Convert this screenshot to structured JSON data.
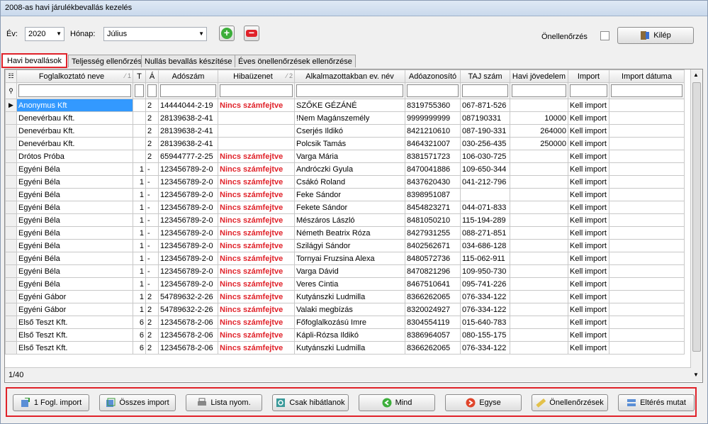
{
  "window": {
    "title": "2008-as havi járulékbevallás kezelés"
  },
  "toolbar": {
    "year_label": "Év:",
    "year_value": "2020",
    "month_label": "Hónap:",
    "month_value": "Július",
    "self_check_label": "Önellenőrzés",
    "exit_label": "Kilép"
  },
  "tabs": [
    {
      "label": "Havi bevallások",
      "active": true
    },
    {
      "label": "Teljesség ellenőrzés"
    },
    {
      "label": "Nullás bevallás készítése"
    },
    {
      "label": "Éves önellenőrzések ellenőrzése"
    }
  ],
  "grid": {
    "columns": [
      "Foglalkoztató neve",
      "T",
      "Á",
      "Adószám",
      "Hibaüzenet",
      "Alkalmazottakban ev. név",
      "Adóazonosító",
      "TAJ szám",
      "Havi jövedelem",
      "Import",
      "Import dátuma"
    ],
    "sort1": "1",
    "sort2": "2",
    "rows": [
      [
        "Anonymus Kft",
        "",
        "2",
        "14444044-2-19",
        "Nincs számfejtve",
        "SZŐKE GÉZÁNÉ",
        "8319755360",
        "067-871-526",
        "",
        "Kell import",
        ""
      ],
      [
        "Denevérbau Kft.",
        "",
        "2",
        "28139638-2-41",
        "",
        "!Nem Magánszemély",
        "9999999999",
        "087190331",
        "10000",
        "Kell import",
        ""
      ],
      [
        "Denevérbau Kft.",
        "",
        "2",
        "28139638-2-41",
        "",
        "Cserjés Ildikó",
        "8421210610",
        "087-190-331",
        "264000",
        "Kell import",
        ""
      ],
      [
        "Denevérbau Kft.",
        "",
        "2",
        "28139638-2-41",
        "",
        "Polcsik Tamás",
        "8464321007",
        "030-256-435",
        "250000",
        "Kell import",
        ""
      ],
      [
        "Drótos Próba",
        "",
        "2",
        "65944777-2-25",
        "Nincs számfejtve",
        "Varga Mária",
        "8381571723",
        "106-030-725",
        "",
        "Kell import",
        ""
      ],
      [
        "Egyéni Béla",
        "1",
        "-",
        "123456789-2-0",
        "Nincs számfejtve",
        "Andróczki Gyula",
        "8470041886",
        "109-650-344",
        "",
        "Kell import",
        ""
      ],
      [
        "Egyéni Béla",
        "1",
        "-",
        "123456789-2-0",
        "Nincs számfejtve",
        "Csákó Roland",
        "8437620430",
        "041-212-796",
        "",
        "Kell import",
        ""
      ],
      [
        "Egyéni Béla",
        "1",
        "-",
        "123456789-2-0",
        "Nincs számfejtve",
        "Feke Sándor",
        "8398951087",
        "",
        "",
        "Kell import",
        ""
      ],
      [
        "Egyéni Béla",
        "1",
        "-",
        "123456789-2-0",
        "Nincs számfejtve",
        "Fekete Sándor",
        "8454823271",
        "044-071-833",
        "",
        "Kell import",
        ""
      ],
      [
        "Egyéni Béla",
        "1",
        "-",
        "123456789-2-0",
        "Nincs számfejtve",
        "Mészáros László",
        "8481050210",
        "115-194-289",
        "",
        "Kell import",
        ""
      ],
      [
        "Egyéni Béla",
        "1",
        "-",
        "123456789-2-0",
        "Nincs számfejtve",
        "Németh Beatrix Róza",
        "8427931255",
        "088-271-851",
        "",
        "Kell import",
        ""
      ],
      [
        "Egyéni Béla",
        "1",
        "-",
        "123456789-2-0",
        "Nincs számfejtve",
        "Szilágyi Sándor",
        "8402562671",
        "034-686-128",
        "",
        "Kell import",
        ""
      ],
      [
        "Egyéni Béla",
        "1",
        "-",
        "123456789-2-0",
        "Nincs számfejtve",
        "Tornyai Fruzsina Alexa",
        "8480572736",
        "115-062-911",
        "",
        "Kell import",
        ""
      ],
      [
        "Egyéni Béla",
        "1",
        "-",
        "123456789-2-0",
        "Nincs számfejtve",
        "Varga Dávid",
        "8470821296",
        "109-950-730",
        "",
        "Kell import",
        ""
      ],
      [
        "Egyéni Béla",
        "1",
        "-",
        "123456789-2-0",
        "Nincs számfejtve",
        "Veres Cintia",
        "8467510641",
        "095-741-226",
        "",
        "Kell import",
        ""
      ],
      [
        "Egyéni Gábor",
        "1",
        "2",
        "54789632-2-26",
        "Nincs számfejtve",
        "Kutyánszki Ludmilla",
        "8366262065",
        "076-334-122",
        "",
        "Kell import",
        ""
      ],
      [
        "Egyéni Gábor",
        "1",
        "2",
        "54789632-2-26",
        "Nincs számfejtve",
        "Valaki megbízás",
        "8320024927",
        "076-334-122",
        "",
        "Kell import",
        ""
      ],
      [
        "Első Teszt Kft.",
        "6",
        "2",
        "12345678-2-06",
        "Nincs számfejtve",
        "Főfoglalkozású Imre",
        "8304554119",
        "015-640-783",
        "",
        "Kell import",
        ""
      ],
      [
        "Első Teszt Kft.",
        "6",
        "2",
        "12345678-2-06",
        "Nincs számfejtve",
        "Kápli-Rózsa Ildikó",
        "8386964057",
        "080-155-175",
        "",
        "Kell import",
        ""
      ],
      [
        "Első Teszt Kft.",
        "6",
        "2",
        "12345678-2-06",
        "Nincs számfejtve",
        "Kutyánszki Ludmilla",
        "8366262065",
        "076-334-122",
        "",
        "Kell import",
        ""
      ]
    ],
    "record_counter": "1/40"
  },
  "bottom_buttons": [
    "1 Fogl. import",
    "Összes import",
    "Lista nyom.",
    "Csak hibátlanok",
    "Mind",
    "Egyse",
    "Önellenőrzések",
    "Eltérés mutat"
  ],
  "colors": {
    "error": "#e0222a",
    "selection": "#3399ff",
    "highlight": "#e0222a"
  }
}
